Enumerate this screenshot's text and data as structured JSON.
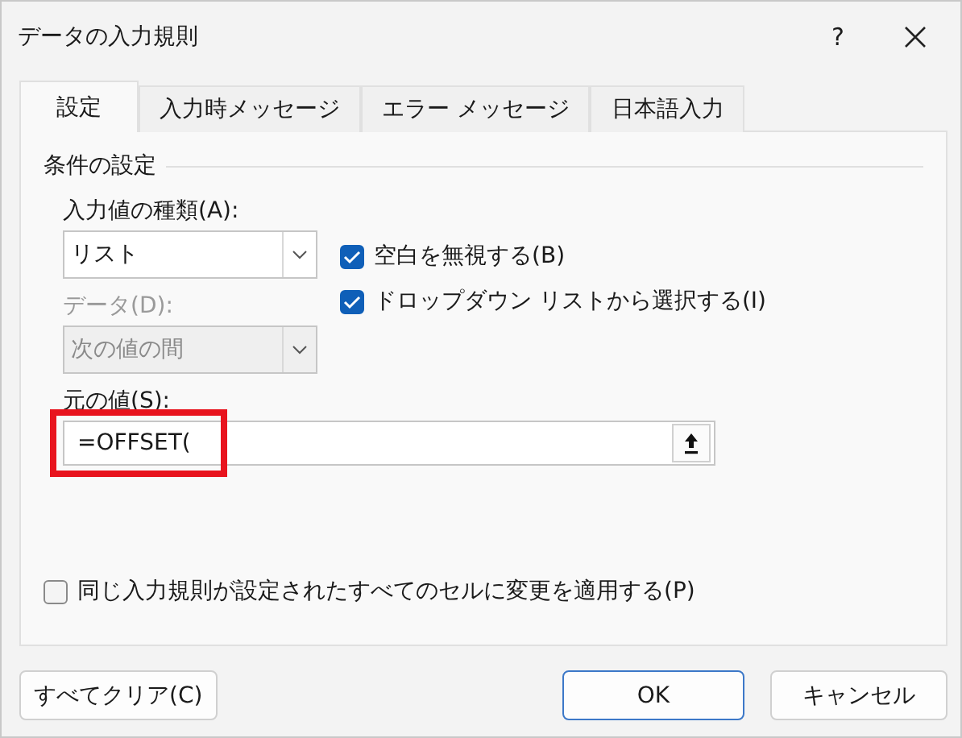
{
  "window": {
    "title": "データの入力規則",
    "help": "?"
  },
  "tabs": [
    {
      "label": "設定",
      "selected": true
    },
    {
      "label": "入力時メッセージ",
      "selected": false
    },
    {
      "label": "エラー メッセージ",
      "selected": false
    },
    {
      "label": "日本語入力",
      "selected": false
    }
  ],
  "group_title": "条件の設定",
  "allow": {
    "label": "入力値の種類(A):",
    "value": "リスト",
    "disabled": false
  },
  "data": {
    "label": "データ(D):",
    "value": "次の値の間",
    "disabled": true
  },
  "options": [
    {
      "label": "空白を無視する(B)",
      "checked": true
    },
    {
      "label": "ドロップダウン リストから選択する(I)",
      "checked": true
    }
  ],
  "source": {
    "label": "元の値(S):",
    "value": "=OFFSET(",
    "highlighted": true
  },
  "apply_all": {
    "label": "同じ入力規則が設定されたすべてのセルに変更を適用する(P)",
    "checked": false
  },
  "buttons": [
    {
      "label": "すべてクリア(C)",
      "kind": "secondary"
    },
    {
      "label": "OK",
      "kind": "default"
    },
    {
      "label": "キャンセル",
      "kind": "secondary"
    }
  ]
}
